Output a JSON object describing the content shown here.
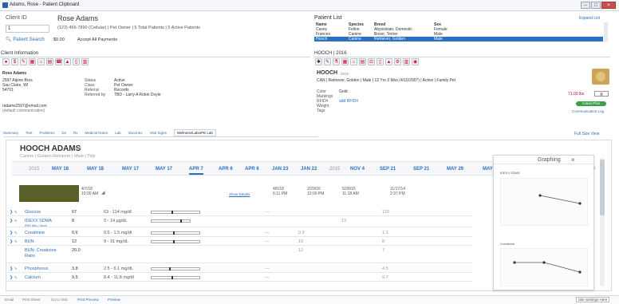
{
  "window": {
    "title": "Adams, Rose - Patient Clipboard"
  },
  "client": {
    "id_label": "Client ID",
    "id_value": "1",
    "name": "Rose Adams",
    "phone_line": "(123) 456-7890 (Cellular) | Pet Owner | 5 Total Patients | 5 Active Patients",
    "search_label": "Patient Search",
    "balance": "$0.00",
    "payment_note": "Accept All Payments",
    "info_label": "Client Information",
    "details_name": "Rose Adams",
    "address1": "2597 Alpine Bros",
    "address2": "Sau Claire, WI",
    "zip": "54701",
    "email": "radams2597@email.com",
    "email_note": "(default communication)",
    "status_label": "Status",
    "status_value": "Active",
    "class_label": "Class",
    "class_value": "Pet Owner",
    "referral_label": "Referral",
    "referral_value": "Records",
    "referred_by_label": "Referred by",
    "referred_by_value": "TBD - Larry A Robin Doyle"
  },
  "patient_list": {
    "title": "Patient List",
    "expand_all": "Expand List",
    "headers": [
      "Name",
      "Species",
      "Breed",
      "Sex"
    ],
    "rows": [
      [
        "Casey",
        "Feline",
        "Abyssinian, Domestic",
        "Female"
      ],
      [
        "Frances",
        "Canine",
        "Boxer, Terrier",
        "Male"
      ],
      [
        "Hooch",
        "Canine",
        "Retriever, Golden",
        "Male"
      ]
    ]
  },
  "patient": {
    "section_label": "HOOCH | 2016",
    "name": "HOOCH",
    "year": "2016",
    "desc": "CAN | Retriever, Golden | Male | 12 Yrs 3 Mos (4/15/2007) | Active | Family Pet",
    "color_label": "Color",
    "color_value": "Gold",
    "markings_label": "Markings",
    "rfid_label": "RFID#",
    "rfid_value": "add RFID#",
    "weight_label": "Weight",
    "tags_label": "Tags",
    "weight_value": "71.00 lbs",
    "active_plan": "Active Plan",
    "communication": "Communication Log"
  },
  "tabs": [
    "Summary",
    "Text",
    "Problems",
    "Dx",
    "Rx",
    "Medical Notes",
    "Lab",
    "Vaccines",
    "Vital Signs",
    "Wellness/Labs/PE Lab"
  ],
  "tab_right": "Full Size View",
  "labs": {
    "patient_name": "HOOCH ADAMS",
    "patient_year": "2016",
    "breed_line": "Canine | Golden Retriever | Male | Tidy",
    "date_tabs": [
      "2015",
      "MAY 18",
      "MAY 18",
      "MAY 17",
      "MAY 17",
      "APR 7",
      "APR 6",
      "APR 6",
      "JAN 23",
      "JAN 22",
      "2015",
      "NOV 4",
      "SEP 21",
      "SEP 21",
      "MAY 29",
      "MAY 28",
      "2014"
    ],
    "col_dates": [
      {
        "d": "4/7/18",
        "t": "10:00 AM"
      },
      {
        "d": "4/6/18",
        "t": "6:11 PM"
      },
      {
        "d": "2/29/16",
        "t": "12:00 PM"
      },
      {
        "d": "5/28/15",
        "t": "11:18 AM"
      },
      {
        "d": "11/17/14",
        "t": "2:37 PM"
      }
    ],
    "show_details": "Show Details",
    "rows": [
      {
        "name": "Glucose",
        "val": "67",
        "range": "63 - 114 mg/dl",
        "c2": "---",
        "c3": "",
        "c4": "",
        "c5": "110"
      },
      {
        "name": "IDEXX SDMA",
        "val": "8",
        "range": "0 - 14 μg/dL",
        "c2": "",
        "c3": "",
        "c4": "13",
        "c5": ""
      },
      {
        "name": "Creatinine",
        "val": "0.6",
        "range": "0.5 - 1.5 mg/dl",
        "c2": "---",
        "c3": "0.9",
        "c4": "",
        "c5": "1.1"
      },
      {
        "name": "BUN",
        "val": "12",
        "range": "9 - 31 mg/dL",
        "c2": "---",
        "c3": "10",
        "c4": "",
        "c5": "8"
      },
      {
        "name": "BUN: Creatinine Ratio",
        "val": "20.0",
        "range": "",
        "c2": "",
        "c3": "12",
        "c4": "",
        "c5": "7"
      },
      {
        "name": "Phosphorus",
        "val": "3.8",
        "range": "2.5 - 6.1 mg/dL",
        "c2": "---",
        "c3": "",
        "c4": "",
        "c5": "4.5"
      },
      {
        "name": "Calcium",
        "val": "9.5",
        "range": "8.4 - 11.8 mg/dl",
        "c2": "---",
        "c3": "",
        "c4": "",
        "c5": "9.7"
      }
    ],
    "sdma_sub": "IRIS Info / more"
  },
  "graphing": {
    "title": "Graphing",
    "chart1_title": "IDEXX SDMA",
    "chart2_title": "Creatinine"
  },
  "footer": {
    "links": [
      "Email",
      "Print Sheet",
      "Go to Visit",
      "Print Preview",
      "Preview"
    ],
    "right": "Site Settings Here"
  },
  "colors": {
    "accent": "#2a6fc0",
    "selected_row": "#2a6fc0",
    "swatch": "#5a5f2a"
  }
}
